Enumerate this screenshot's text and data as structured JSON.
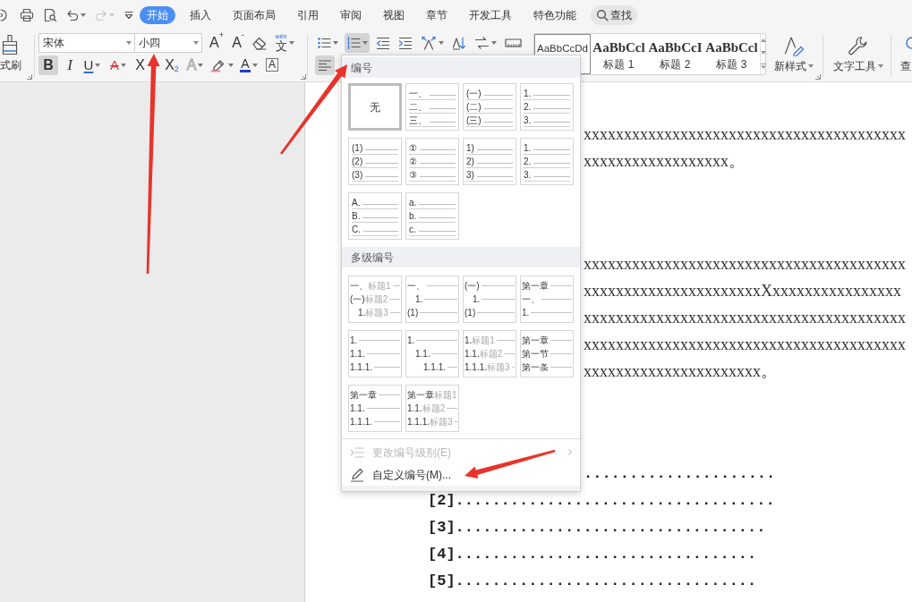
{
  "quick_access": [
    {
      "kind": "hook",
      "disabled": false
    },
    {
      "kind": "print",
      "disabled": false
    },
    {
      "kind": "preview",
      "disabled": false
    },
    {
      "kind": "undo",
      "caret": true,
      "disabled": false
    },
    {
      "kind": "redo",
      "caret": true,
      "disabled": true
    },
    {
      "kind": "customize",
      "disabled": false
    }
  ],
  "tabs": [
    {
      "label": "开始",
      "selected": true
    },
    {
      "label": "插入",
      "selected": false
    },
    {
      "label": "页面布局",
      "selected": false
    },
    {
      "label": "引用",
      "selected": false
    },
    {
      "label": "审阅",
      "selected": false
    },
    {
      "label": "视图",
      "selected": false
    },
    {
      "label": "章节",
      "selected": false
    },
    {
      "label": "开发工具",
      "selected": false
    },
    {
      "label": "特色功能",
      "selected": false
    }
  ],
  "search": {
    "label": "查找"
  },
  "ribbon": {
    "clipboard": {
      "label": "式刷"
    },
    "font": {
      "name": "宋体",
      "size": "小四"
    },
    "font_tools": [
      {
        "kind": "grow",
        "glyph": "A$^{+}$",
        "selected": false
      },
      {
        "kind": "shrink",
        "glyph": "A$^{-}$",
        "selected": false
      },
      {
        "kind": "clear",
        "selected": false
      },
      {
        "kind": "pinyin",
        "glyph": "文",
        "ruby": "wén",
        "caret": true,
        "selected": false
      }
    ],
    "format_tools": [
      {
        "kind": "bold",
        "glyph": "B",
        "selected": true
      },
      {
        "kind": "italic",
        "glyph": "I",
        "selected": false
      },
      {
        "kind": "underline",
        "glyph": "U",
        "caret": true,
        "selected": false
      },
      {
        "kind": "strikethrough",
        "glyph": "A",
        "caret": true,
        "selected": false
      },
      {
        "kind": "superscript",
        "glyph": "X",
        "selected": false
      },
      {
        "kind": "subscript",
        "glyph": "X$_{2}$",
        "selected": false
      },
      {
        "kind": "text-effect",
        "glyph": "A",
        "caret": true,
        "selected": false
      },
      {
        "kind": "highlight",
        "caret": true,
        "selected": false
      },
      {
        "kind": "font-color",
        "glyph": "A",
        "caret": true,
        "selected": false
      },
      {
        "kind": "character-border",
        "glyph": "A",
        "selected": false
      }
    ],
    "paragraph_tools": [
      {
        "kind": "bullets",
        "caret": true,
        "selected": false
      },
      {
        "kind": "numbering",
        "caret": true,
        "selected": true
      },
      {
        "kind": "outdent",
        "selected": false
      },
      {
        "kind": "indent",
        "selected": false
      },
      {
        "kind": "layout",
        "caret": true,
        "selected": false
      },
      {
        "kind": "sort",
        "selected": false
      },
      {
        "kind": "line-spacing",
        "caret": true,
        "selected": false
      },
      {
        "kind": "table",
        "selected": false
      }
    ],
    "align_tools": [
      {
        "kind": "align-left",
        "selected": true
      }
    ],
    "styles": [
      {
        "kind": "body",
        "preview": "AaBbCcDd",
        "selected": true
      },
      {
        "kind": "heading",
        "preview": "AaBbCcl",
        "label": "标题 1",
        "selected": false
      },
      {
        "kind": "heading",
        "preview": "AaBbCcI",
        "label": "标题 2",
        "selected": false
      },
      {
        "kind": "heading",
        "preview": "AaBbCcl",
        "label": "标题 3",
        "selected": false
      }
    ],
    "buttons": [
      {
        "kind": "new-style",
        "label": "新样式",
        "caret": true
      },
      {
        "kind": "text-tools",
        "label": "文字工具",
        "caret": true
      },
      {
        "kind": "find",
        "label": "查"
      }
    ]
  },
  "numbering_menu": {
    "sections": [
      {
        "title": "编号",
        "tiles": [
          {
            "kind": "none",
            "label": "无",
            "selected": true
          },
          {
            "kind": "list",
            "selected": false,
            "rows": [
              {
                "number": "一、"
              },
              {
                "number": "二、"
              },
              {
                "number": "三、"
              }
            ]
          },
          {
            "kind": "list",
            "selected": false,
            "rows": [
              {
                "number": "(一)"
              },
              {
                "number": "(二)"
              },
              {
                "number": "(三)"
              }
            ]
          },
          {
            "kind": "list",
            "selected": false,
            "rows": [
              {
                "number": "1."
              },
              {
                "number": "2."
              },
              {
                "number": "3."
              }
            ]
          },
          {
            "kind": "list",
            "selected": false,
            "rows": [
              {
                "number": "(1)"
              },
              {
                "number": "(2)"
              },
              {
                "number": "(3)"
              }
            ]
          },
          {
            "kind": "list",
            "selected": false,
            "rows": [
              {
                "number": "①"
              },
              {
                "number": "②"
              },
              {
                "number": "③"
              }
            ]
          },
          {
            "kind": "list",
            "selected": false,
            "rows": [
              {
                "number": "1)"
              },
              {
                "number": "2)"
              },
              {
                "number": "3)"
              }
            ]
          },
          {
            "kind": "list",
            "selected": false,
            "rows": [
              {
                "number": "1."
              },
              {
                "number": "2."
              },
              {
                "number": "3."
              }
            ]
          },
          {
            "kind": "list",
            "selected": false,
            "rows": [
              {
                "number": "A."
              },
              {
                "number": "B."
              },
              {
                "number": "C."
              }
            ]
          },
          {
            "kind": "list",
            "selected": false,
            "rows": [
              {
                "number": "a."
              },
              {
                "number": "b."
              },
              {
                "number": "c."
              }
            ]
          }
        ]
      },
      {
        "title": "多级编号",
        "tiles": [
          {
            "kind": "outline",
            "selected": false,
            "rows": [
              {
                "number": "一、",
                "heading": "标题1"
              },
              {
                "number": "(一)",
                "heading": "标题2",
                "children": [
                  {
                    "number": "1.",
                    "heading": "标题3"
                  }
                ]
              }
            ]
          },
          {
            "kind": "outline",
            "selected": false,
            "rows": [
              {
                "number": "一、",
                "children": [
                  {
                    "number": "1."
                  }
                ]
              },
              {
                "number": "(1)"
              }
            ]
          },
          {
            "kind": "outline",
            "selected": false,
            "rows": [
              {
                "number": "(一)",
                "children": [
                  {
                    "number": "1."
                  }
                ]
              },
              {
                "number": "(1)"
              }
            ]
          },
          {
            "kind": "outline",
            "selected": false,
            "rows": [
              {
                "number": "第一章"
              },
              {
                "number": "一、"
              },
              {
                "number": "1."
              }
            ]
          },
          {
            "kind": "outline",
            "selected": false,
            "rows": [
              {
                "number": "1."
              },
              {
                "number": "1.1."
              },
              {
                "number": "1.1.1."
              }
            ]
          },
          {
            "kind": "outline",
            "selected": false,
            "rows": [
              {
                "number": "1.",
                "children": [
                  {
                    "number": "1.1.",
                    "children": [
                      {
                        "number": "1.1.1."
                      }
                    ]
                  }
                ]
              }
            ]
          },
          {
            "kind": "outline",
            "selected": false,
            "rows": [
              {
                "number": "1.",
                "heading": "标题1"
              },
              {
                "number": "1.1.",
                "heading": "标题2"
              },
              {
                "number": "1.1.1.",
                "heading": "标题3"
              }
            ]
          },
          {
            "kind": "outline",
            "selected": false,
            "rows": [
              {
                "number": "第一章"
              },
              {
                "number": "第一节"
              },
              {
                "number": "第一条"
              }
            ]
          },
          {
            "kind": "outline",
            "selected": false,
            "rows": [
              {
                "number": "第一章"
              },
              {
                "number": "1.1."
              },
              {
                "number": "1.1.1."
              }
            ]
          },
          {
            "kind": "outline",
            "selected": false,
            "rows": [
              {
                "number": "第一章",
                "heading": "标题1"
              },
              {
                "number": "1.1.",
                "heading": "标题2"
              },
              {
                "number": "1.1.1.",
                "heading": "标题3"
              }
            ]
          }
        ]
      }
    ],
    "items": [
      {
        "kind": "change-level",
        "label": "更改编号级别(E)",
        "disabled": true,
        "submenu": true
      },
      {
        "kind": "custom",
        "label": "自定义编号(M)...",
        "disabled": false
      }
    ]
  },
  "document": {
    "paragraphs": [
      {
        "kind": "text",
        "lines": [
          {
            "text": "xxxxxxxxxxxxxxxxxxxxxxxxxxxxxxxxxxxxxxxx",
            "covered": true
          },
          {
            "text": "xxxxxxxxxxxxxxxxxx。",
            "covered": true
          }
        ]
      },
      {
        "kind": "text",
        "lines": [
          {
            "text": "xxxxxxxxxxxxxxxxxxxxxxxxxxxxxxxxxxxxxxxx",
            "covered": true
          },
          {
            "text": "xxxxxxxxxxxxxxxxxxxxxxXxxxxxxxxxxxxxxxx",
            "covered": true
          },
          {
            "text": "xxxxxxxxxxxxxxxxxxxxxxxxxxxxxxxxxxxxxxxx",
            "covered": true
          },
          {
            "text": "xxxxxxxxxxxxxxxxxxxxxxxxxxxxxxxxxxxxxxxx",
            "covered": true
          },
          {
            "text": "xxxxxxxxxxxxxxxxxxxxxx。",
            "covered": true
          }
        ]
      },
      {
        "kind": "entries",
        "lines": [
          {
            "text": ".....................",
            "covered": true
          },
          {
            "text": "[2]...................................",
            "covered": false
          },
          {
            "text": "[3]..................................",
            "covered": false
          },
          {
            "text": "[4].................................",
            "covered": false
          },
          {
            "text": "[5].................................",
            "covered": false
          }
        ]
      }
    ]
  }
}
